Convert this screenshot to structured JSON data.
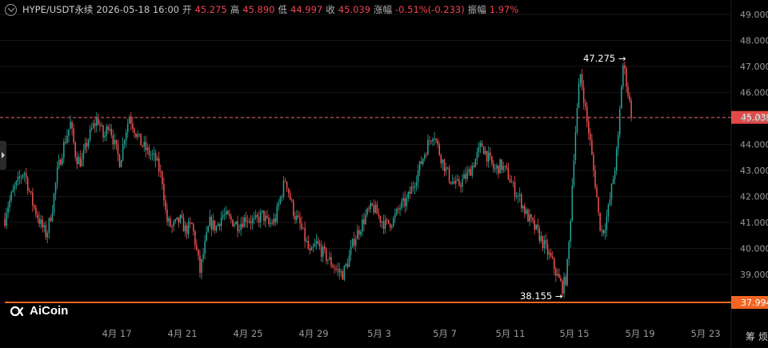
{
  "header": {
    "symbol": "HYPE/USDT永续",
    "datetime": "2026-05-18 16:00",
    "open_label": "开",
    "open": "45.275",
    "high_label": "高",
    "high": "45.890",
    "low_label": "低",
    "low": "44.997",
    "close_label": "收",
    "close": "45.039",
    "change_label": "涨幅",
    "change": "-0.51%(-0.233)",
    "amplitude_label": "振幅",
    "amplitude": "1.97%"
  },
  "logo_text": "AiCoin",
  "corner_text": "筹 烦",
  "colors": {
    "up": "#26a69a",
    "down": "#ef5350",
    "price_line": "#e35a5a",
    "support_line": "#f26522",
    "background": "#000000"
  },
  "chart_data": {
    "type": "candlestick",
    "interval": "hourly",
    "y_axis": {
      "position": "right",
      "ylim": [
        38.55,
        49.2
      ],
      "ticks": [
        "49.000",
        "48.000",
        "47.000",
        "46.000",
        "45.000",
        "44.000",
        "43.000",
        "42.000",
        "41.000",
        "40.000",
        "39.000"
      ]
    },
    "x_axis": {
      "ticks": [
        "4月 17",
        "4月 21",
        "4月 25",
        "4月 29",
        "5月 3",
        "5月 7",
        "5月 11",
        "5月 15",
        "5月 19",
        "5月 23"
      ]
    },
    "last_price": {
      "value": 45.039,
      "label": "45.039"
    },
    "support_line": {
      "value": 37.994,
      "label": "37.994"
    },
    "annotations": [
      {
        "text": "47.275",
        "value": 47.275,
        "position": "high"
      },
      {
        "text": "38.155",
        "value": 38.155,
        "position": "low"
      }
    ],
    "close_path_anchors": [
      [
        0,
        40.0
      ],
      [
        8,
        41.5
      ],
      [
        18,
        42.3
      ],
      [
        30,
        43.0
      ],
      [
        40,
        41.8
      ],
      [
        50,
        41.0
      ],
      [
        58,
        40.5
      ],
      [
        65,
        41.5
      ],
      [
        72,
        43.0
      ],
      [
        80,
        44.0
      ],
      [
        88,
        44.8
      ],
      [
        95,
        43.5
      ],
      [
        102,
        43.3
      ],
      [
        108,
        44.0
      ],
      [
        115,
        44.6
      ],
      [
        122,
        45.0
      ],
      [
        130,
        44.2
      ],
      [
        136,
        44.9
      ],
      [
        143,
        44.0
      ],
      [
        150,
        43.3
      ],
      [
        156,
        44.4
      ],
      [
        162,
        45.1
      ],
      [
        168,
        44.6
      ],
      [
        175,
        44.1
      ],
      [
        185,
        43.7
      ],
      [
        195,
        43.4
      ],
      [
        203,
        42.6
      ],
      [
        208,
        41.1
      ],
      [
        215,
        40.8
      ],
      [
        225,
        41.1
      ],
      [
        232,
        40.7
      ],
      [
        240,
        40.9
      ],
      [
        247,
        39.7
      ],
      [
        250,
        39.1
      ],
      [
        256,
        40.1
      ],
      [
        262,
        41.0
      ],
      [
        270,
        40.8
      ],
      [
        278,
        41.3
      ],
      [
        288,
        41.1
      ],
      [
        298,
        40.9
      ],
      [
        308,
        41.2
      ],
      [
        318,
        41.0
      ],
      [
        328,
        41.3
      ],
      [
        336,
        40.9
      ],
      [
        344,
        41.1
      ],
      [
        350,
        41.9
      ],
      [
        357,
        42.7
      ],
      [
        362,
        42.0
      ],
      [
        368,
        41.3
      ],
      [
        375,
        40.9
      ],
      [
        382,
        40.3
      ],
      [
        388,
        39.7
      ],
      [
        395,
        40.2
      ],
      [
        402,
        39.9
      ],
      [
        410,
        39.6
      ],
      [
        420,
        39.2
      ],
      [
        428,
        39.0
      ],
      [
        435,
        39.5
      ],
      [
        442,
        40.3
      ],
      [
        450,
        40.8
      ],
      [
        458,
        41.3
      ],
      [
        466,
        41.6
      ],
      [
        474,
        41.2
      ],
      [
        482,
        40.9
      ],
      [
        492,
        41.1
      ],
      [
        500,
        41.6
      ],
      [
        508,
        41.8
      ],
      [
        516,
        42.4
      ],
      [
        523,
        43.0
      ],
      [
        530,
        43.6
      ],
      [
        536,
        44.1
      ],
      [
        542,
        44.5
      ],
      [
        548,
        43.8
      ],
      [
        555,
        43.2
      ],
      [
        562,
        42.7
      ],
      [
        570,
        42.4
      ],
      [
        578,
        42.6
      ],
      [
        586,
        42.9
      ],
      [
        594,
        43.4
      ],
      [
        602,
        44.0
      ],
      [
        610,
        43.5
      ],
      [
        618,
        43.0
      ],
      [
        626,
        43.2
      ],
      [
        634,
        42.9
      ],
      [
        642,
        42.3
      ],
      [
        650,
        41.9
      ],
      [
        658,
        41.3
      ],
      [
        666,
        40.9
      ],
      [
        674,
        40.5
      ],
      [
        682,
        40.0
      ],
      [
        690,
        39.5
      ],
      [
        697,
        38.9
      ],
      [
        703,
        38.5
      ],
      [
        708,
        38.9
      ],
      [
        712,
        40.5
      ],
      [
        715,
        42.3
      ],
      [
        718,
        44.0
      ],
      [
        722,
        45.5
      ],
      [
        725,
        46.8
      ],
      [
        729,
        46.0
      ],
      [
        733,
        45.0
      ],
      [
        737,
        44.3
      ],
      [
        741,
        43.2
      ],
      [
        745,
        42.3
      ],
      [
        749,
        41.0
      ],
      [
        753,
        40.6
      ],
      [
        757,
        41.0
      ],
      [
        761,
        41.6
      ],
      [
        765,
        42.4
      ],
      [
        769,
        43.2
      ],
      [
        773,
        44.3
      ],
      [
        776,
        46.0
      ],
      [
        779,
        47.1
      ],
      [
        782,
        46.6
      ],
      [
        786,
        45.8
      ],
      [
        790,
        45.04
      ]
    ]
  }
}
